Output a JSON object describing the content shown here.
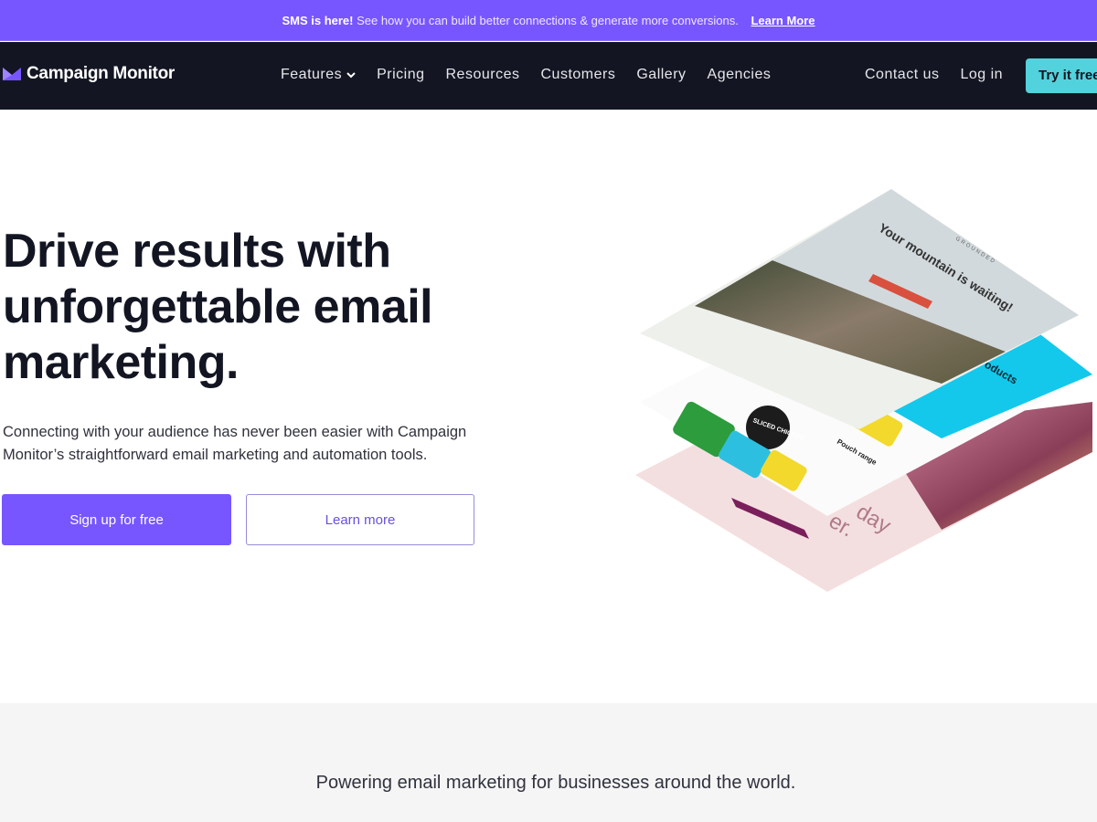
{
  "banner": {
    "bold": "SMS is here!",
    "text": "See how you can build better connections & generate more conversions.",
    "link": "Learn More"
  },
  "nav": {
    "logo": "Campaign Monitor",
    "links": [
      "Features",
      "Pricing",
      "Resources",
      "Customers",
      "Gallery",
      "Agencies"
    ],
    "contact": "Contact us",
    "login": "Log in",
    "try": "Try it free"
  },
  "hero": {
    "headline": "Drive results with unforgettable email marketing.",
    "lead": "Connecting with your audience has never been easier with Campaign Monitor’s straightforward email marketing and automation tools.",
    "primary": "Sign up for free",
    "secondary": "Learn more"
  },
  "illustration": {
    "title": "Your mountain is waiting!",
    "brand": "GROUNDED",
    "products": "Products",
    "pouch": "Pouch range",
    "chicken": "SLICED CHICKEN",
    "day": "day",
    "er": "er."
  },
  "band": {
    "text": "Powering email marketing for businesses around the world."
  },
  "colors": {
    "accent": "#7856ff",
    "nav": "#131622",
    "cta": "#52d2dc"
  }
}
